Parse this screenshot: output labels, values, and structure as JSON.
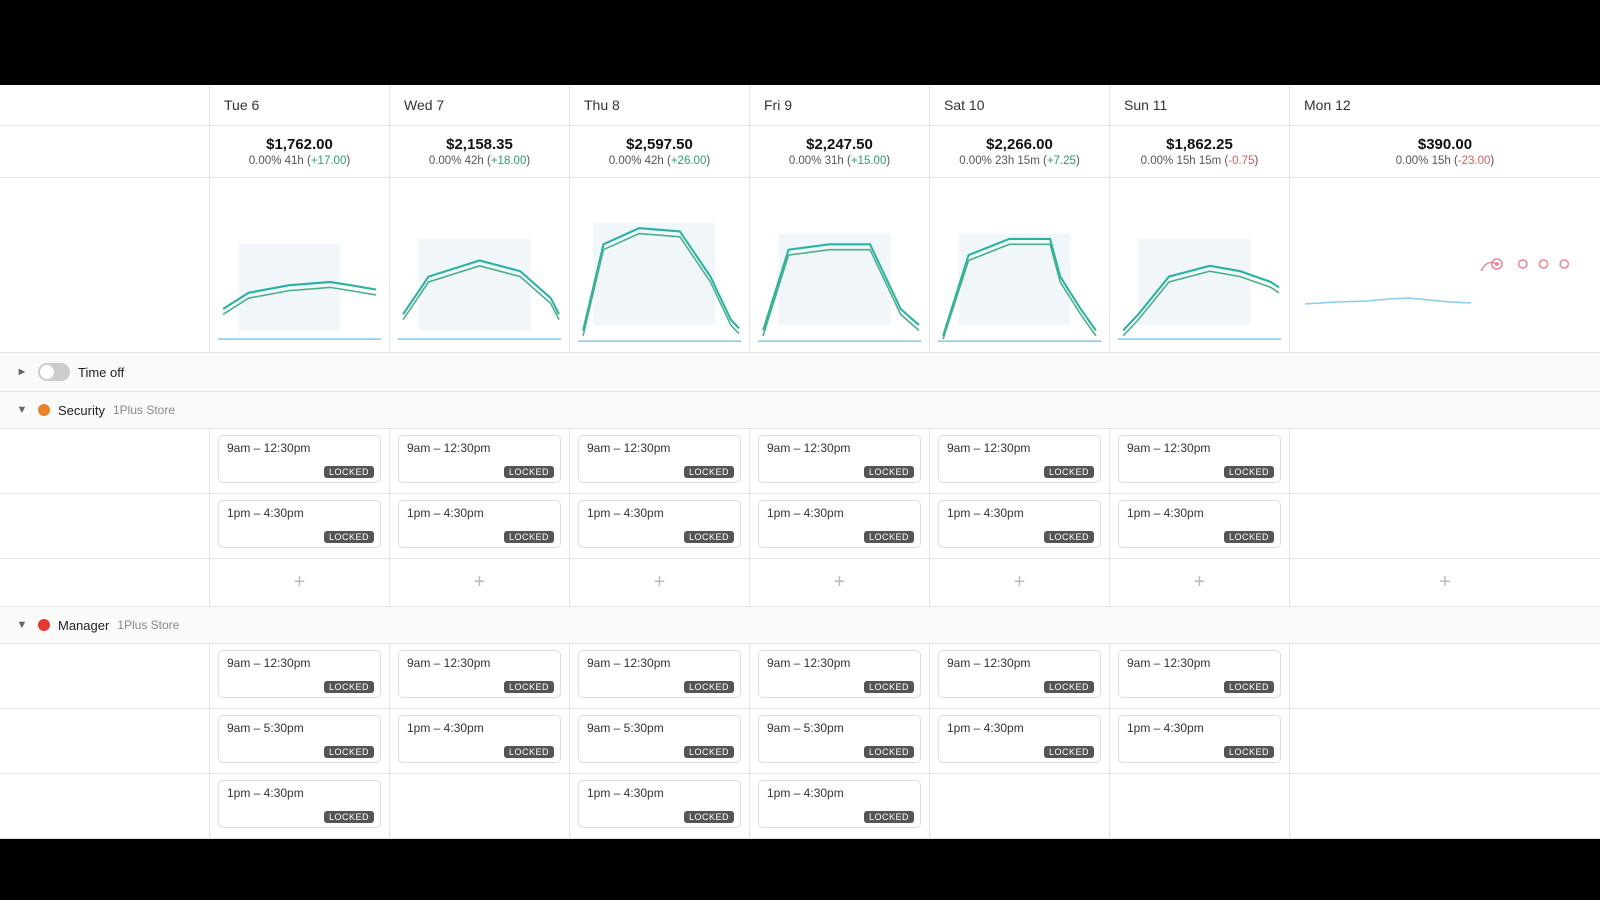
{
  "topBar": {
    "height": 85
  },
  "days": [
    {
      "id": "tue6",
      "label": "Tue 6",
      "amount": "$1,762.00",
      "pct": "0.00%",
      "hours": "41h",
      "change": "+17.00",
      "changeSign": "positive"
    },
    {
      "id": "wed7",
      "label": "Wed 7",
      "amount": "$2,158.35",
      "pct": "0.00%",
      "hours": "42h",
      "change": "+18.00",
      "changeSign": "positive"
    },
    {
      "id": "thu8",
      "label": "Thu 8",
      "amount": "$2,597.50",
      "pct": "0.00%",
      "hours": "42h",
      "change": "+26.00",
      "changeSign": "positive"
    },
    {
      "id": "fri9",
      "label": "Fri 9",
      "amount": "$2,247.50",
      "pct": "0.00%",
      "hours": "31h",
      "change": "+15.00",
      "changeSign": "positive"
    },
    {
      "id": "sat10",
      "label": "Sat 10",
      "amount": "$2,266.00",
      "pct": "0.00%",
      "hours": "23h 15m",
      "change": "+7.25",
      "changeSign": "positive"
    },
    {
      "id": "sun11",
      "label": "Sun 11",
      "amount": "$1,862.25",
      "pct": "0.00%",
      "hours": "15h 15m",
      "change": "-0.75",
      "changeSign": "negative"
    },
    {
      "id": "mon12",
      "label": "Mon 12",
      "amount": "$390.00",
      "pct": "0.00%",
      "hours": "15h",
      "change": "-23.00",
      "changeSign": "negative"
    }
  ],
  "timeOffRow": {
    "label": "Time off"
  },
  "groups": [
    {
      "id": "security",
      "label": "Security",
      "store": "1Plus Store",
      "dotClass": "dot-orange",
      "shiftRows": [
        {
          "shifts": [
            {
              "time": "9am – 12:30pm",
              "locked": true
            },
            {
              "time": "9am – 12:30pm",
              "locked": true
            },
            {
              "time": "9am – 12:30pm",
              "locked": true
            },
            {
              "time": "9am – 12:30pm",
              "locked": true
            },
            {
              "time": "9am – 12:30pm",
              "locked": true
            },
            {
              "time": "9am – 12:30pm",
              "locked": true
            },
            {
              "time": "",
              "locked": false,
              "empty": true
            }
          ]
        },
        {
          "shifts": [
            {
              "time": "1pm – 4:30pm",
              "locked": true
            },
            {
              "time": "1pm – 4:30pm",
              "locked": true
            },
            {
              "time": "1pm – 4:30pm",
              "locked": true
            },
            {
              "time": "1pm – 4:30pm",
              "locked": true
            },
            {
              "time": "1pm – 4:30pm",
              "locked": true
            },
            {
              "time": "1pm – 4:30pm",
              "locked": true
            },
            {
              "time": "",
              "locked": false,
              "empty": true
            }
          ]
        }
      ],
      "addRow": [
        "+",
        "+",
        "+",
        "+",
        "+",
        "+",
        "+"
      ]
    },
    {
      "id": "manager",
      "label": "Manager",
      "store": "1Plus Store",
      "dotClass": "dot-red",
      "shiftRows": [
        {
          "shifts": [
            {
              "time": "9am – 12:30pm",
              "locked": true
            },
            {
              "time": "9am – 12:30pm",
              "locked": true
            },
            {
              "time": "9am – 12:30pm",
              "locked": true
            },
            {
              "time": "9am – 12:30pm",
              "locked": true
            },
            {
              "time": "9am – 12:30pm",
              "locked": true
            },
            {
              "time": "9am – 12:30pm",
              "locked": true
            },
            {
              "time": "",
              "locked": false,
              "empty": true
            }
          ]
        },
        {
          "shifts": [
            {
              "time": "9am – 5:30pm",
              "locked": true
            },
            {
              "time": "1pm – 4:30pm",
              "locked": true
            },
            {
              "time": "9am – 5:30pm",
              "locked": true
            },
            {
              "time": "9am – 5:30pm",
              "locked": true
            },
            {
              "time": "1pm – 4:30pm",
              "locked": true
            },
            {
              "time": "1pm – 4:30pm",
              "locked": true
            },
            {
              "time": "",
              "locked": false,
              "empty": true
            }
          ]
        },
        {
          "shifts": [
            {
              "time": "1pm – 4:30pm",
              "locked": true
            },
            {
              "time": "",
              "locked": false,
              "empty": true
            },
            {
              "time": "1pm – 4:30pm",
              "locked": true
            },
            {
              "time": "1pm – 4:30pm",
              "locked": true
            },
            {
              "time": "",
              "locked": false,
              "empty": true
            },
            {
              "time": "",
              "locked": false,
              "empty": true
            },
            {
              "time": "",
              "locked": false,
              "empty": true
            }
          ]
        }
      ]
    }
  ],
  "lockedLabel": "LOCKED",
  "addLabel": "+"
}
